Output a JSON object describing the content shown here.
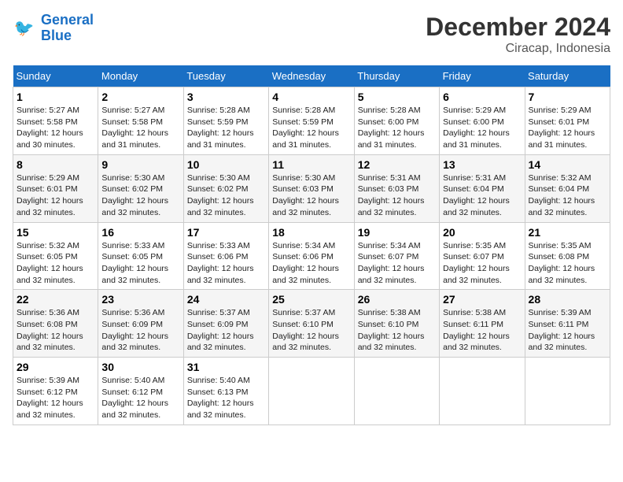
{
  "header": {
    "logo_line1": "General",
    "logo_line2": "Blue",
    "main_title": "December 2024",
    "subtitle": "Ciracap, Indonesia"
  },
  "calendar": {
    "days_of_week": [
      "Sunday",
      "Monday",
      "Tuesday",
      "Wednesday",
      "Thursday",
      "Friday",
      "Saturday"
    ],
    "weeks": [
      [
        null,
        null,
        null,
        null,
        null,
        null,
        null
      ]
    ]
  },
  "days": {
    "d1": {
      "num": "1",
      "rise": "5:27 AM",
      "set": "5:58 PM",
      "hours": "12 hours and 30 minutes."
    },
    "d2": {
      "num": "2",
      "rise": "5:27 AM",
      "set": "5:58 PM",
      "hours": "12 hours and 31 minutes."
    },
    "d3": {
      "num": "3",
      "rise": "5:28 AM",
      "set": "5:59 PM",
      "hours": "12 hours and 31 minutes."
    },
    "d4": {
      "num": "4",
      "rise": "5:28 AM",
      "set": "5:59 PM",
      "hours": "12 hours and 31 minutes."
    },
    "d5": {
      "num": "5",
      "rise": "5:28 AM",
      "set": "6:00 PM",
      "hours": "12 hours and 31 minutes."
    },
    "d6": {
      "num": "6",
      "rise": "5:29 AM",
      "set": "6:00 PM",
      "hours": "12 hours and 31 minutes."
    },
    "d7": {
      "num": "7",
      "rise": "5:29 AM",
      "set": "6:01 PM",
      "hours": "12 hours and 31 minutes."
    },
    "d8": {
      "num": "8",
      "rise": "5:29 AM",
      "set": "6:01 PM",
      "hours": "12 hours and 32 minutes."
    },
    "d9": {
      "num": "9",
      "rise": "5:30 AM",
      "set": "6:02 PM",
      "hours": "12 hours and 32 minutes."
    },
    "d10": {
      "num": "10",
      "rise": "5:30 AM",
      "set": "6:02 PM",
      "hours": "12 hours and 32 minutes."
    },
    "d11": {
      "num": "11",
      "rise": "5:30 AM",
      "set": "6:03 PM",
      "hours": "12 hours and 32 minutes."
    },
    "d12": {
      "num": "12",
      "rise": "5:31 AM",
      "set": "6:03 PM",
      "hours": "12 hours and 32 minutes."
    },
    "d13": {
      "num": "13",
      "rise": "5:31 AM",
      "set": "6:04 PM",
      "hours": "12 hours and 32 minutes."
    },
    "d14": {
      "num": "14",
      "rise": "5:32 AM",
      "set": "6:04 PM",
      "hours": "12 hours and 32 minutes."
    },
    "d15": {
      "num": "15",
      "rise": "5:32 AM",
      "set": "6:05 PM",
      "hours": "12 hours and 32 minutes."
    },
    "d16": {
      "num": "16",
      "rise": "5:33 AM",
      "set": "6:05 PM",
      "hours": "12 hours and 32 minutes."
    },
    "d17": {
      "num": "17",
      "rise": "5:33 AM",
      "set": "6:06 PM",
      "hours": "12 hours and 32 minutes."
    },
    "d18": {
      "num": "18",
      "rise": "5:34 AM",
      "set": "6:06 PM",
      "hours": "12 hours and 32 minutes."
    },
    "d19": {
      "num": "19",
      "rise": "5:34 AM",
      "set": "6:07 PM",
      "hours": "12 hours and 32 minutes."
    },
    "d20": {
      "num": "20",
      "rise": "5:35 AM",
      "set": "6:07 PM",
      "hours": "12 hours and 32 minutes."
    },
    "d21": {
      "num": "21",
      "rise": "5:35 AM",
      "set": "6:08 PM",
      "hours": "12 hours and 32 minutes."
    },
    "d22": {
      "num": "22",
      "rise": "5:36 AM",
      "set": "6:08 PM",
      "hours": "12 hours and 32 minutes."
    },
    "d23": {
      "num": "23",
      "rise": "5:36 AM",
      "set": "6:09 PM",
      "hours": "12 hours and 32 minutes."
    },
    "d24": {
      "num": "24",
      "rise": "5:37 AM",
      "set": "6:09 PM",
      "hours": "12 hours and 32 minutes."
    },
    "d25": {
      "num": "25",
      "rise": "5:37 AM",
      "set": "6:10 PM",
      "hours": "12 hours and 32 minutes."
    },
    "d26": {
      "num": "26",
      "rise": "5:38 AM",
      "set": "6:10 PM",
      "hours": "12 hours and 32 minutes."
    },
    "d27": {
      "num": "27",
      "rise": "5:38 AM",
      "set": "6:11 PM",
      "hours": "12 hours and 32 minutes."
    },
    "d28": {
      "num": "28",
      "rise": "5:39 AM",
      "set": "6:11 PM",
      "hours": "12 hours and 32 minutes."
    },
    "d29": {
      "num": "29",
      "rise": "5:39 AM",
      "set": "6:12 PM",
      "hours": "12 hours and 32 minutes."
    },
    "d30": {
      "num": "30",
      "rise": "5:40 AM",
      "set": "6:12 PM",
      "hours": "12 hours and 32 minutes."
    },
    "d31": {
      "num": "31",
      "rise": "5:40 AM",
      "set": "6:13 PM",
      "hours": "12 hours and 32 minutes."
    }
  },
  "labels": {
    "sunrise": "Sunrise:",
    "sunset": "Sunset:",
    "daylight": "Daylight:"
  }
}
